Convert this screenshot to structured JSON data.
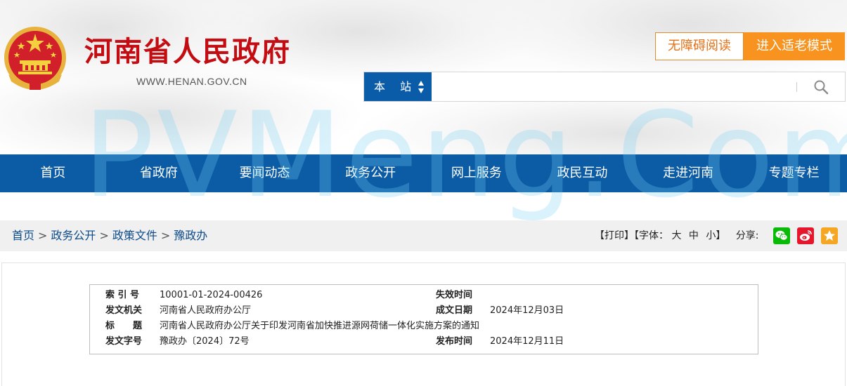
{
  "header": {
    "title": "河南省人民政府",
    "url": "WWW.HENAN.GOV.CN",
    "accessibility_label": "无障碍阅读",
    "elder_mode_label": "进入适老模式"
  },
  "search": {
    "scope_label": "本 站",
    "placeholder": ""
  },
  "watermark": "PVMeng.Com",
  "nav": {
    "items": [
      "首页",
      "省政府",
      "要闻动态",
      "政务公开",
      "网上服务",
      "政民互动",
      "走进河南",
      "专题专栏"
    ]
  },
  "breadcrumb": {
    "items": [
      "首页",
      "政务公开",
      "政策文件",
      "豫政办"
    ],
    "separator": ">"
  },
  "tools": {
    "print_label": "【打印】",
    "font_size_prefix": "【字体：",
    "font_large": "大",
    "font_medium": "中",
    "font_small": "小",
    "font_size_suffix": "】",
    "share_label": "分享:"
  },
  "document_info": {
    "index_key": "索 引 号",
    "index_value": "10001-01-2024-00426",
    "expiry_key": "失效时间",
    "expiry_value": "",
    "issuer_key": "发文机关",
    "issuer_value": "河南省人民政府办公厅",
    "written_date_key": "成文日期",
    "written_date_value": "2024年12月03日",
    "title_key": "标　　题",
    "title_value": "河南省人民政府办公厅关于印发河南省加快推进源网荷储一体化实施方案的通知",
    "doc_number_key": "发文字号",
    "doc_number_value": "豫政办〔2024〕72号",
    "publish_date_key": "发布时间",
    "publish_date_value": "2024年12月11日"
  },
  "colors": {
    "brand_red": "#c40d12",
    "nav_blue": "#0b5ca5",
    "accent_orange": "#f7931e",
    "wechat_green": "#09bb07",
    "weibo_red": "#e6162d",
    "favorite_orange": "#f5a623"
  }
}
